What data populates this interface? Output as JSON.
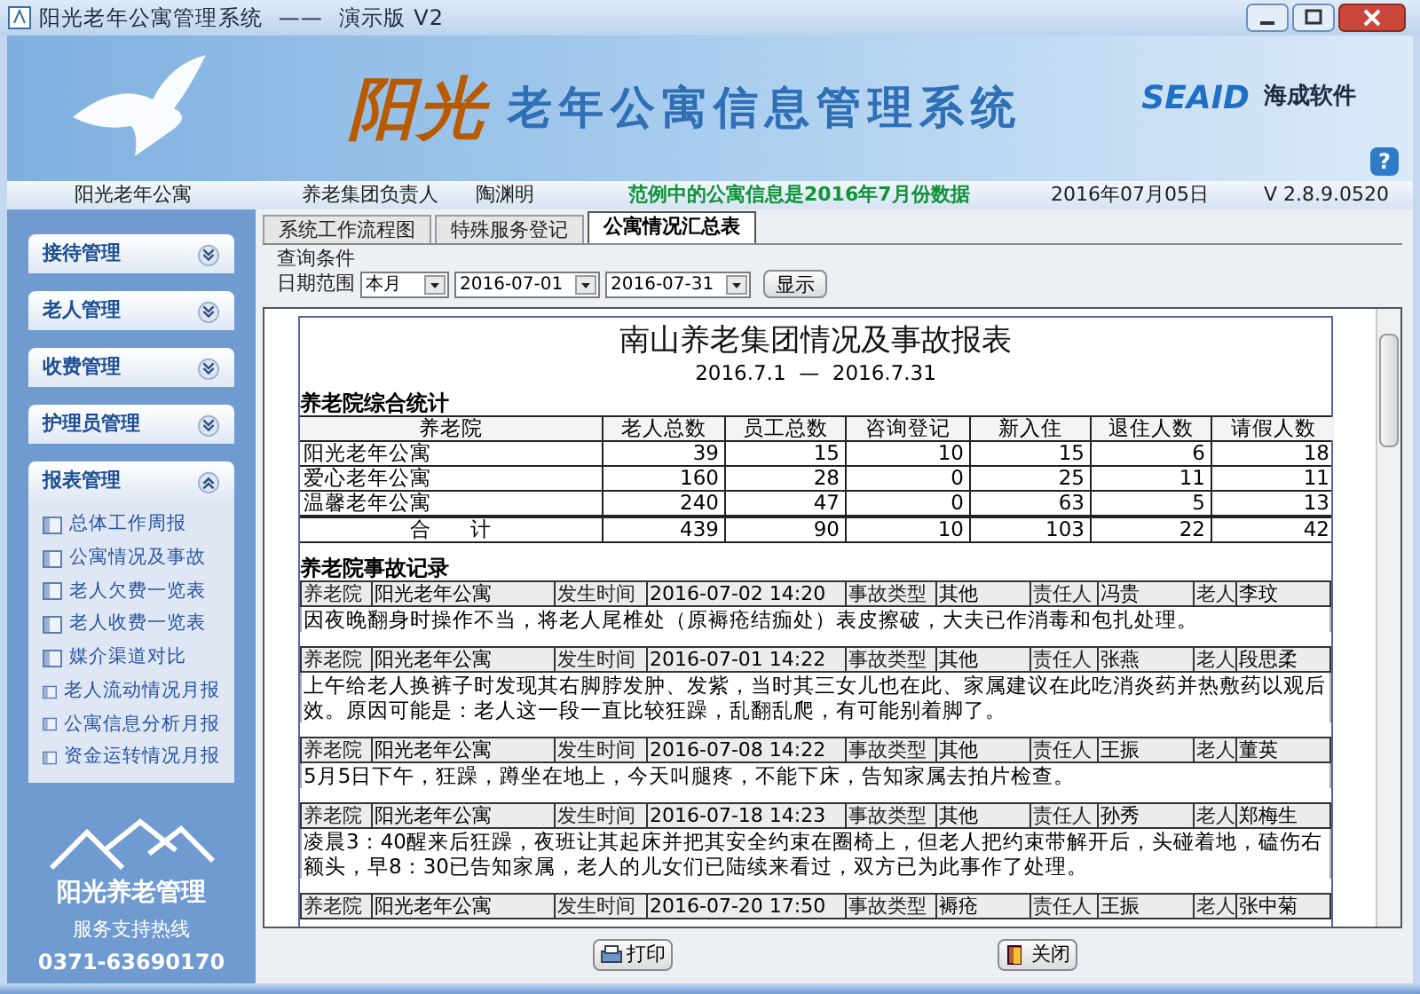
{
  "window": {
    "title": "阳光老年公寓管理系统  ——  演示版 V2"
  },
  "banner": {
    "logo_main": "阳光",
    "logo_title": "老年公寓信息管理系统",
    "brand": "SEAID",
    "brand_cn": "海成软件",
    "help": "?"
  },
  "info_bar": {
    "apartment": "阳光老年公寓",
    "role": "养老集团负责人",
    "user": "陶渊明",
    "notice": "范例中的公寓信息是2016年7月份数据",
    "date": "2016年07月05日",
    "version": "V 2.8.9.0520"
  },
  "sidebar": {
    "sections": [
      {
        "label": "接待管理",
        "expanded": false
      },
      {
        "label": "老人管理",
        "expanded": false
      },
      {
        "label": "收费管理",
        "expanded": false
      },
      {
        "label": "护理员管理",
        "expanded": false
      },
      {
        "label": "报表管理",
        "expanded": true,
        "items": [
          "总体工作周报",
          "公寓情况及事故",
          "老人欠费一览表",
          "老人收费一览表",
          "媒介渠道对比",
          "老人流动情况月报",
          "公寓信息分析月报",
          "资金运转情况月报"
        ]
      }
    ],
    "footer": {
      "name": "阳光养老管理",
      "hotline_label": "服务支持热线",
      "phone": "0371-63690170"
    }
  },
  "tabs": [
    {
      "label": "系统工作流程图",
      "selected": false
    },
    {
      "label": "特殊服务登记",
      "selected": false
    },
    {
      "label": "公寓情况汇总表",
      "selected": true
    }
  ],
  "query": {
    "group_label": "查询条件",
    "range_label": "日期范围",
    "period": "本月",
    "start": "2016-07-01",
    "end": "2016-07-31",
    "button": "显示"
  },
  "report": {
    "title": "南山养老集团情况及事故报表",
    "period": "2016.7.1  —  2016.7.31",
    "stats_title": "养老院综合统计",
    "stats_columns": [
      "养老院",
      "老人总数",
      "员工总数",
      "咨询登记",
      "新入住",
      "退住人数",
      "请假人数"
    ],
    "stats_rows": [
      [
        "阳光老年公寓",
        "39",
        "15",
        "10",
        "15",
        "6",
        "18"
      ],
      [
        "爱心老年公寓",
        "160",
        "28",
        "0",
        "25",
        "11",
        "11"
      ],
      [
        "温馨老年公寓",
        "240",
        "47",
        "0",
        "63",
        "5",
        "13"
      ]
    ],
    "stats_total": [
      "合      计",
      "439",
      "90",
      "10",
      "103",
      "22",
      "42"
    ],
    "incidents_title": "养老院事故记录",
    "incidents": [
      {
        "cells": [
          "养老院",
          "阳光老年公寓",
          "发生时间",
          "2016-07-02 14:20",
          "事故类型",
          "其他",
          "责任人",
          "冯贵",
          "老人",
          "李玟"
        ],
        "description": "因夜晚翻身时操作不当，将老人尾椎处（原褥疮结痂处）表皮擦破，大夫已作消毒和包扎处理。"
      },
      {
        "cells": [
          "养老院",
          "阳光老年公寓",
          "发生时间",
          "2016-07-01 14:22",
          "事故类型",
          "其他",
          "责任人",
          "张燕",
          "老人",
          "段思柔"
        ],
        "description": "上午给老人换裤子时发现其右脚脖发肿、发紫，当时其三女儿也在此、家属建议在此吃消炎药并热敷药以观后效。原因可能是：老人这一段一直比较狂躁，乱翻乱爬，有可能别着脚了。"
      },
      {
        "cells": [
          "养老院",
          "阳光老年公寓",
          "发生时间",
          "2016-07-08 14:22",
          "事故类型",
          "其他",
          "责任人",
          "王振",
          "老人",
          "董英"
        ],
        "description": "5月5日下午，狂躁，蹲坐在地上，今天叫腿疼，不能下床，告知家属去拍片检查。"
      },
      {
        "cells": [
          "养老院",
          "阳光老年公寓",
          "发生时间",
          "2016-07-18 14:23",
          "事故类型",
          "其他",
          "责任人",
          "孙秀",
          "老人",
          "郑梅生"
        ],
        "description": "凌晨3：40醒来后狂躁，夜班让其起床并把其安全约束在圈椅上，但老人把约束带解开后，头碰着地，磕伤右额头，早8：30已告知家属，老人的儿女们已陆续来看过，双方已为此事作了处理。"
      },
      {
        "cells": [
          "养老院",
          "阳光老年公寓",
          "发生时间",
          "2016-07-20 17:50",
          "事故类型",
          "褥疮",
          "责任人",
          "王振",
          "老人",
          "张中菊"
        ]
      }
    ]
  },
  "buttons": [
    {
      "label": "打印",
      "kind": "print"
    },
    {
      "label": "关闭",
      "kind": "close"
    }
  ]
}
